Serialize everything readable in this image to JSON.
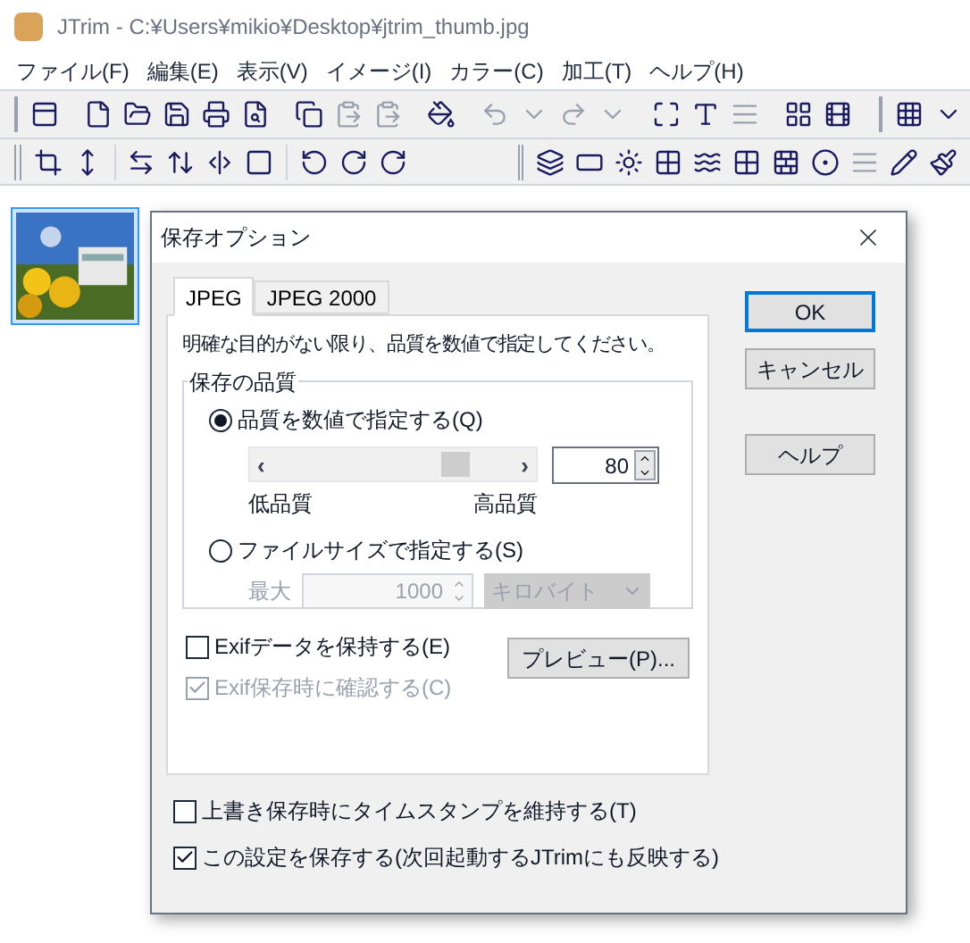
{
  "window": {
    "title": "JTrim - C:¥Users¥mikio¥Desktop¥jtrim_thumb.jpg"
  },
  "menu": [
    "ファイル(F)",
    "編集(E)",
    "表示(V)",
    "イメージ(I)",
    "カラー(C)",
    "加工(T)",
    "ヘルプ(H)"
  ],
  "thumbnail": {
    "kind": "picture",
    "selected": true
  },
  "dialog": {
    "title": "保存オプション",
    "tabs": [
      {
        "label": "JPEG",
        "selected": true
      },
      {
        "label": "JPEG 2000",
        "selected": false
      }
    ],
    "instruction": "明確な目的がない限り、品質を数値で指定してください。",
    "group_label": "保存の品質",
    "quality_option": {
      "label": "品質を数値で指定する(Q)",
      "selected": true
    },
    "quality_slider": {
      "left": "‹",
      "right": "›",
      "level": 0.72
    },
    "quality_value": "80",
    "low_label": "低品質",
    "high_label": "高品質",
    "size_option": {
      "label": "ファイルサイズで指定する(S)",
      "selected": false
    },
    "size_max_label": "最大",
    "size_value": "1000",
    "size_unit": "キロバイト",
    "size_disabled": true,
    "exif_checks": [
      {
        "label": "Exifデータを保持する(E)",
        "checked": false,
        "disabled": false
      },
      {
        "label": "Exif保存時に確認する(C)",
        "checked": true,
        "disabled": true
      }
    ],
    "preview_button": "プレビュー(P)...",
    "bottom_checks": [
      {
        "label": "上書き保存時にタイムスタンプを維持する(T)",
        "checked": false,
        "disabled": false
      },
      {
        "label": "この設定を保存する(次回起動するJTrimにも反映する)",
        "checked": true,
        "disabled": false
      }
    ],
    "buttons": [
      {
        "label": "OK",
        "kind": "default"
      },
      {
        "label": "キャンセル",
        "kind": "normal"
      },
      {
        "label": "ヘルプ",
        "kind": "help"
      }
    ]
  }
}
